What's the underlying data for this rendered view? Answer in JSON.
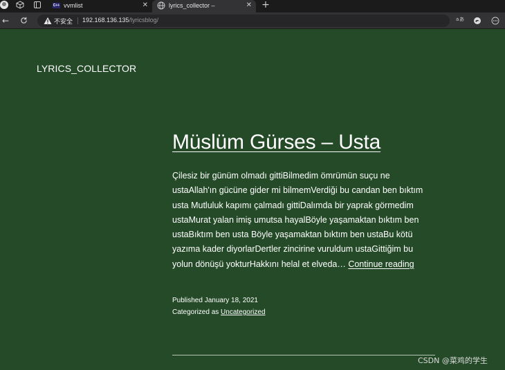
{
  "browser": {
    "tabs": [
      {
        "label": "vvmlist",
        "favicon": "cpp-icon",
        "active": false
      },
      {
        "label": "lyrics_collector –",
        "favicon": "globe-icon",
        "active": true
      }
    ],
    "security_label": "不安全",
    "url_host": "192.168.136.135",
    "url_path": "/lyricsblog/"
  },
  "site": {
    "title": "LYRICS_COLLECTOR"
  },
  "post": {
    "title": "Müslüm Gürses – Usta",
    "excerpt": "Çilesiz bir günüm olmadı gittiBilmedim ömrümün suçu ne ustaAllah'ın gücüne gider mi bilmemVerdiği bu candan ben bıktım usta Mutluluk kapımı çalmadı gittiDalımda bir yaprak görmedim ustaMurat yalan imiş umutsa hayalBöyle yaşamaktan bıktım ben ustaBıktım ben usta Böyle yaşamaktan bıktım ben ustaBu kötü yazıma kader diyorlarDertler zincirine vuruldum ustaGittiğim bu yolun dönüşü yokturHakkını helal et elveda…",
    "read_more": "Continue reading",
    "published": "Published January 18, 2021",
    "category_prefix": "Categorized as ",
    "category": "Uncategorized"
  },
  "watermark": "CSDN @菜鸡的学生",
  "colors": {
    "page_background": "#244a28",
    "chrome_dark": "#1b1b1b",
    "chrome_bar": "#333336"
  }
}
